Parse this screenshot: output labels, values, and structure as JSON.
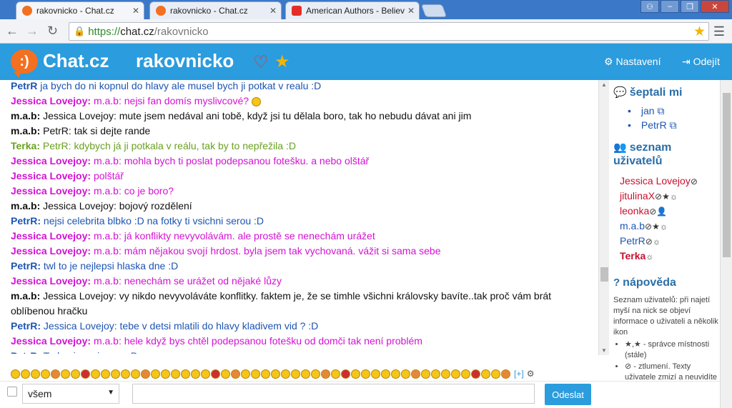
{
  "browser": {
    "tabs": [
      {
        "title": "rakovnicko - Chat.cz",
        "active": true
      },
      {
        "title": "rakovnicko - Chat.cz",
        "active": false
      },
      {
        "title": "American Authors - Believer",
        "active": false
      }
    ],
    "url_scheme": "https://",
    "url_host": "chat.cz",
    "url_path": "/rakovnicko"
  },
  "header": {
    "site_name": "Chat.cz",
    "room_name": "rakovnicko",
    "settings_label": "Nastavení",
    "logout_label": "Odejít"
  },
  "messages": [
    {
      "nick": "PetrR",
      "color": "#1d55b3",
      "text": " ja bych do ni kopnul do hlavy ale musel bych ji potkat v realu :D",
      "textColor": "#1d55b3"
    },
    {
      "nick": "Jessica Lovejoy:",
      "color": "#d312d3",
      "text": " m.a.b: nejsi fan domís myslivcové?",
      "textColor": "#d312d3",
      "smiley": true
    },
    {
      "nick": "m.a.b:",
      "color": "#111111",
      "text": " Jessica Lovejoy: mute jsem nedával ani tobě, když jsi tu dělala boro, tak ho nebudu dávat ani jim",
      "textColor": "#111111"
    },
    {
      "nick": "m.a.b:",
      "color": "#111111",
      "text": " PetrR: tak si dejte rande",
      "textColor": "#111111"
    },
    {
      "nick": "Terka:",
      "color": "#6aa121",
      "text": " PetrR: kdybych já ji potkala v reálu, tak by to nepřežila :D",
      "textColor": "#6aa121"
    },
    {
      "nick": "Jessica Lovejoy:",
      "color": "#d312d3",
      "text": " m.a.b: mohla bych ti poslat podepsanou fotešku. a nebo olštář",
      "textColor": "#d312d3"
    },
    {
      "nick": "Jessica Lovejoy:",
      "color": "#d312d3",
      "text": " polštář",
      "textColor": "#d312d3"
    },
    {
      "nick": "Jessica Lovejoy:",
      "color": "#d312d3",
      "text": " m.a.b: co je boro?",
      "textColor": "#d312d3"
    },
    {
      "nick": "m.a.b:",
      "color": "#111111",
      "text": " Jessica Lovejoy: bojový rozdělení",
      "textColor": "#111111"
    },
    {
      "nick": "PetrR:",
      "color": "#1d55b3",
      "text": " nejsi celebrita blbko :D na fotky ti vsichni serou :D",
      "textColor": "#1d55b3"
    },
    {
      "nick": "Jessica Lovejoy:",
      "color": "#d312d3",
      "text": " m.a.b: já konflikty nevyvolávám. ale prostě se nenechám urážet",
      "textColor": "#d312d3"
    },
    {
      "nick": "Jessica Lovejoy:",
      "color": "#d312d3",
      "text": " m.a.b: mám nějakou svojí hrdost. byla jsem tak vychovaná. vážit si sama sebe",
      "textColor": "#d312d3"
    },
    {
      "nick": "PetrR:",
      "color": "#1d55b3",
      "text": " twl to je nejlepsi hlaska dne :D",
      "textColor": "#1d55b3"
    },
    {
      "nick": "Jessica Lovejoy:",
      "color": "#d312d3",
      "text": " m.a.b: nenechám se urážet od nějaké lůzy",
      "textColor": "#d312d3"
    },
    {
      "nick": "m.a.b:",
      "color": "#111111",
      "text": " Jessica Lovejoy: vy nikdo nevyvoláváte konflitky. faktem je, že se timhle všichni královsky bavíte..tak proč vám brát oblíbenou hračku",
      "textColor": "#111111",
      "wrap": true
    },
    {
      "nick": "PetrR:",
      "color": "#1d55b3",
      "text": " Jessica Lovejoy: tebe v detsi mlatili do hlavy kladivem vid ? :D",
      "textColor": "#1d55b3"
    },
    {
      "nick": "Jessica Lovejoy:",
      "color": "#d312d3",
      "text": " m.a.b: hele když bys chtěl podepsanou fotešku od domči tak není problém",
      "textColor": "#d312d3"
    },
    {
      "nick": "PetrR:",
      "color": "#1d55b3",
      "text": " Terka: ja z ni umru :D",
      "textColor": "#1d55b3"
    }
  ],
  "sidebar": {
    "whispered_title": "šeptali mi",
    "whispered": [
      "jan",
      "PetrR"
    ],
    "users_title": "seznam uživatelů",
    "users": [
      {
        "name": "Jessica Lovejoy",
        "color": "#c8102e",
        "badges": "⊘"
      },
      {
        "name": "jitulinaX",
        "color": "#c8102e",
        "badges": "⊘★☼"
      },
      {
        "name": "leonka",
        "color": "#c8102e",
        "badges": "⊘👤"
      },
      {
        "name": "m.a.b",
        "color": "#1d55b3",
        "badges": "⊘★☼"
      },
      {
        "name": "PetrR",
        "color": "#1d55b3",
        "badges": "⊘☼"
      },
      {
        "name": "Terka",
        "color": "#c8102e",
        "badges": "☼",
        "bold": true
      }
    ],
    "help_title": "nápověda",
    "help_intro": "Seznam uživatelů: při najetí myší na nick se objeví informace o uživateli a několik ikon",
    "help_items": [
      "★,★ - správce místnosti (stále)",
      "⊘ - ztlumení. Texty uživatele zmizí a neuvidíte ani jeho šeptání. Nick ztlumeného uživatele"
    ]
  },
  "bottom": {
    "emoticons_more": "[+]",
    "recipient": "všem",
    "message_value": "",
    "send_label": "Odeslat"
  }
}
